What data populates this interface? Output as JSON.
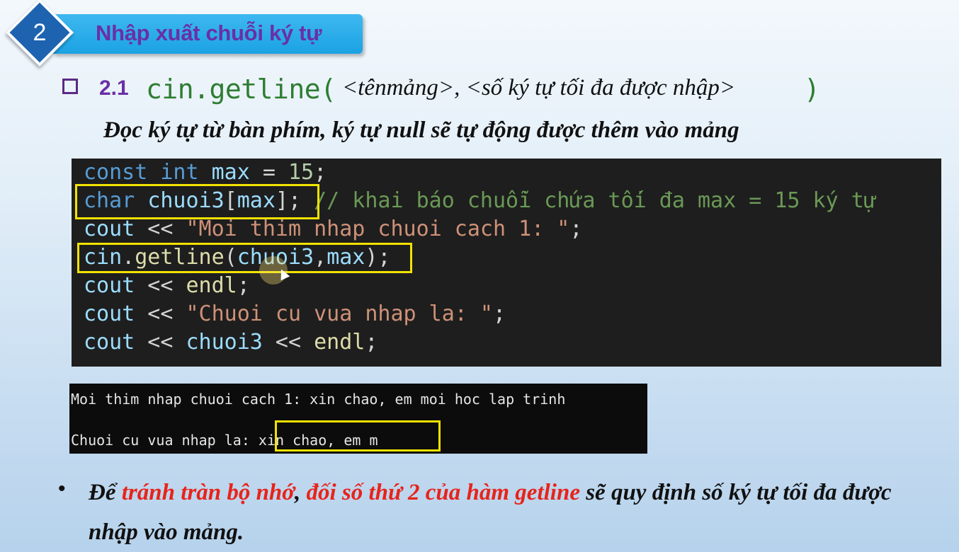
{
  "section": {
    "number": "2",
    "title": "Nhập xuất chuỗi ký tự"
  },
  "subheading": {
    "number": "2.1",
    "function": "cin.getline(",
    "args": "<tênmảng>, <số ký tự tối đa được nhập>",
    "close": ")"
  },
  "description": "Đọc ký tự từ bàn phím, ký tự null sẽ tự động được thêm vào mảng",
  "code": {
    "l1": {
      "a": "const",
      "b": " ",
      "c": "int",
      "d": " ",
      "e": "max",
      "f": " = ",
      "g": "15",
      "h": ";"
    },
    "l2": {
      "a": "char",
      "b": " ",
      "c": "chuoi3",
      "d": "[",
      "e": "max",
      "f": "];",
      "g": " // khai báo chuỗi chứa tối đa max = 15 ký tự"
    },
    "l3": {
      "a": "cout",
      "b": " << ",
      "c": "\"Moi thim nhap chuoi cach 1: \"",
      "d": ";"
    },
    "l4": {
      "a": "cin",
      "b": ".",
      "c": "getline",
      "d": "(",
      "e": "chuoi3",
      "f": ",",
      "g": "max",
      "h": ");"
    },
    "l5": {
      "a": "cout",
      "b": " << ",
      "c": "endl",
      "d": ";"
    },
    "l6": {
      "a": "cout",
      "b": " << ",
      "c": "\"Chuoi cu vua nhap la: \"",
      "d": ";"
    },
    "l7": {
      "a": "cout",
      "b": " << ",
      "c": "chuoi3",
      "d": " << ",
      "e": "endl",
      "f": ";"
    }
  },
  "console": {
    "line1": "Moi thim nhap chuoi cach 1: xin chao, em moi hoc lap trinh",
    "line2_prefix": "Chuoi cu vua nhap la: ",
    "line2_value": "xin chao, em m"
  },
  "note": {
    "bullet": "•",
    "p1": "Để ",
    "p2": "tránh tràn bộ nhớ",
    "p3": ", ",
    "p4": "đối số thứ 2 của hàm getline",
    "p5": " sẽ quy định số ký tự tối đa được nhập vào mảng."
  },
  "colors": {
    "banner": "#1aa2e4",
    "title_purple": "#6b2fa5",
    "diamond": "#1d63b0",
    "highlight_box": "#f2e200",
    "emphasis_red": "#e8231a"
  }
}
